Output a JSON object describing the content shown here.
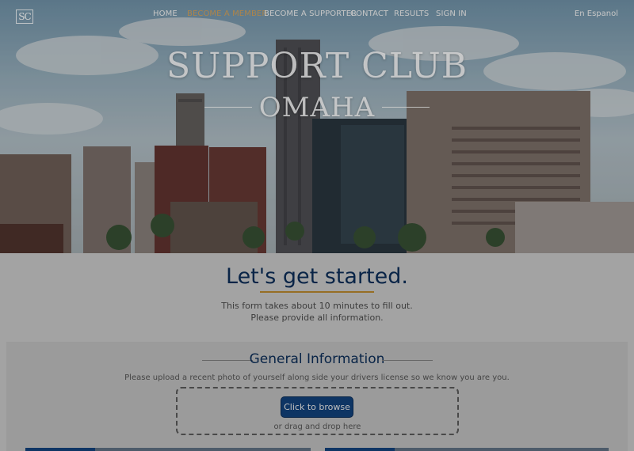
{
  "brand": {
    "logo_text": "SC"
  },
  "nav": {
    "items": [
      {
        "label": "HOME"
      },
      {
        "label": "BECOME A MEMBER"
      },
      {
        "label": "BECOME A SUPPORTER"
      },
      {
        "label": "CONTACT"
      },
      {
        "label": "RESULTS"
      },
      {
        "label": "SIGN IN"
      }
    ],
    "language_link": "En Espanol"
  },
  "hero": {
    "title": "SUPPORT CLUB",
    "subtitle": "OMAHA"
  },
  "intro": {
    "heading": "Let's get started.",
    "line1": "This form takes about 10 minutes to fill out.",
    "line2": "Please provide all information."
  },
  "general": {
    "title": "General Information",
    "upload_note": "Please upload a recent photo of yourself along side your drivers license so we know you are you.",
    "browse_label": "Click to browse",
    "drag_label": "or drag and drop here"
  },
  "colors": {
    "active_nav": "#d3a25c",
    "heading": "#0b2d57",
    "button": "#12417a",
    "accent_line": "#b8872c"
  }
}
